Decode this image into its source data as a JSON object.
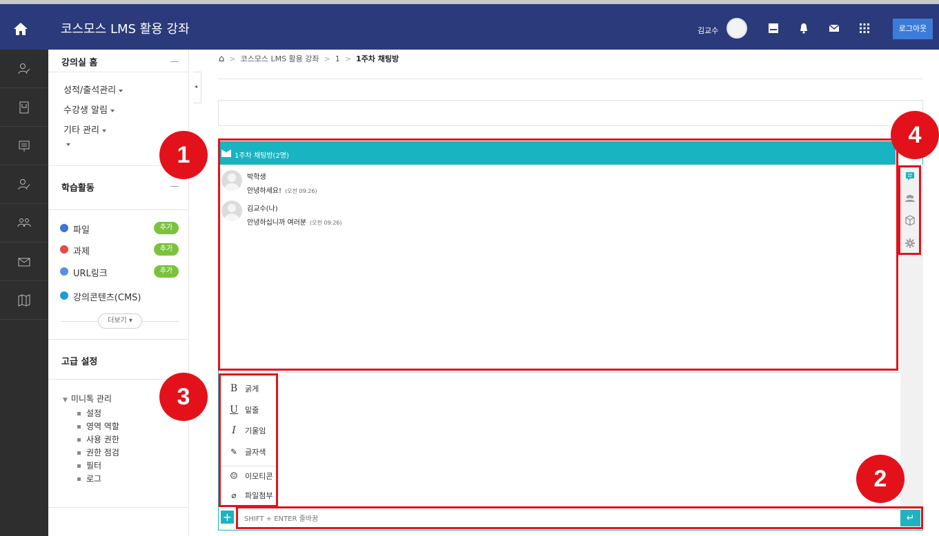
{
  "header": {
    "title": "코스모스 LMS 활용 강좌",
    "username": "김교수",
    "logout_label": "로그아웃"
  },
  "menu": {
    "home_label": "강의실 홈",
    "items": [
      "성적/출석관리",
      "수강생 알림",
      "기타 관리"
    ],
    "activities_title": "학습활동",
    "activities": [
      {
        "label": "파일",
        "add": "추가",
        "color": "#3f74d9"
      },
      {
        "label": "과제",
        "add": "추가",
        "color": "#e44b4b"
      },
      {
        "label": "URL링크",
        "add": "추가",
        "color": "#5a8fe0"
      },
      {
        "label": "강의콘텐츠(CMS)",
        "add": "",
        "color": "#1f9ad6"
      }
    ],
    "more_label": "더보기",
    "advanced_title": "고급 설정",
    "advanced_group": "미니톡 관리",
    "advanced_items": [
      "설정",
      "영역 역할",
      "사용 권한",
      "권한 점검",
      "필터",
      "로그"
    ]
  },
  "breadcrumb": {
    "course": "코스모스 LMS 활용 강좌",
    "section": "1",
    "current": "1주차 채팅방"
  },
  "chat": {
    "header_title": "1주차 채팅방(2명)",
    "messages": [
      {
        "name": "박학생",
        "text": "안녕하세요!",
        "time": "(오전 09:26)"
      },
      {
        "name": "김교수(나)",
        "text": "안녕하십니까 여러분",
        "time": "(오전 09:26)"
      }
    ],
    "tools": [
      {
        "icon": "B",
        "label": "굵게"
      },
      {
        "icon": "U",
        "label": "밑줄"
      },
      {
        "icon": "I",
        "label": "기울임"
      },
      {
        "icon": "palette-icon",
        "label": "글자색"
      },
      {
        "icon": "smiley-icon",
        "label": "이모티콘"
      },
      {
        "icon": "paperclip-icon",
        "label": "파일첨부"
      }
    ],
    "input_placeholder": "SHIFT + ENTER 줄바꿈"
  },
  "annotations": [
    "1",
    "2",
    "3",
    "4"
  ],
  "colors": {
    "topbar": "#2b3a7a",
    "rail": "#2e2e2e",
    "chat_accent": "#18b4c1",
    "add_badge": "#7cc23f",
    "annotation_red": "#e3121a"
  }
}
